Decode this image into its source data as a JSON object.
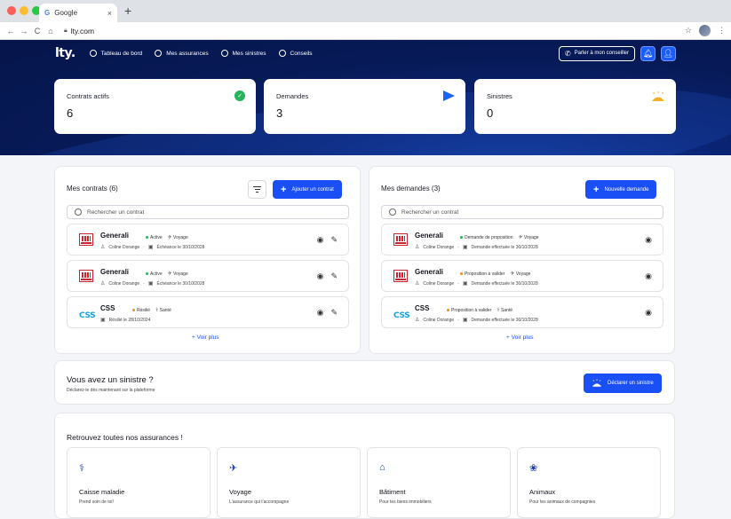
{
  "browser": {
    "tab_title": "Google",
    "tab_favicon": "G",
    "url": "lty.com",
    "new_tab": "+",
    "close": "×"
  },
  "topnav": {
    "logo": "lty.",
    "items": [
      "Tableau de bord",
      "Mes assurances",
      "Mes sinistres",
      "Conseils"
    ],
    "advisor_button": "Parler à mon conseiller"
  },
  "stats": [
    {
      "label": "Contrats actifs",
      "value": "6",
      "icon": "check-circle-icon",
      "color": "#25b35d"
    },
    {
      "label": "Demandes",
      "value": "3",
      "icon": "send-icon",
      "color": "#1a63f7"
    },
    {
      "label": "Sinistres",
      "value": "0",
      "icon": "umbrella-rain-icon",
      "color": "#f0b020"
    }
  ],
  "contracts": {
    "title": "Mes contrats (6)",
    "add_button": "Ajouter un contrat",
    "search_placeholder": "Rechercher un contrat",
    "see_more": "+ Voir plus",
    "items": [
      {
        "insurer": "Generali",
        "status": "Active",
        "status_color": "#25b35d",
        "category": "Voyage",
        "holder": "Coline Dorange",
        "date": "Échéance le 30/10/2028"
      },
      {
        "insurer": "Generali",
        "status": "Active",
        "status_color": "#25b35d",
        "category": "Voyage",
        "holder": "Coline Dorange",
        "date": "Échéance le 30/10/2028"
      },
      {
        "insurer": "CSS",
        "status": "Résilié",
        "status_color": "#f08a1c",
        "category": "Santé",
        "holder": "",
        "date": "Résilié le 28/10/2024"
      }
    ]
  },
  "requests": {
    "title": "Mes demandes (3)",
    "new_button": "Nouvelle demande",
    "search_placeholder": "Rechercher un contrat",
    "see_more": "+ Voir plus",
    "items": [
      {
        "insurer": "Generali",
        "status": "Demande de proposition",
        "status_color": "#25b35d",
        "category": "Voyage",
        "holder": "Coline Dorange",
        "date": "Demande effectuée le 30/10/2028"
      },
      {
        "insurer": "Generali",
        "status": "Proposition à valider",
        "status_color": "#f08a1c",
        "category": "Voyage",
        "holder": "Coline Dorange",
        "date": "Demande effectuée le 30/10/2028"
      },
      {
        "insurer": "CSS",
        "status": "Proposition à valider",
        "status_color": "#f08a1c",
        "category": "Santé",
        "holder": "Coline Dorange",
        "date": "Demande effectuée le 30/10/2028"
      }
    ]
  },
  "claim": {
    "title": "Vous avez un sinistre ?",
    "subtitle": "Déclarez-le dès maintenant sur la plateforme",
    "button": "Déclarer un sinistre"
  },
  "assurances": {
    "title": "Retrouvez toutes nos assurances !",
    "items": [
      {
        "title": "Caisse maladie",
        "subtitle": "Prend soin de toi!",
        "icon": "health-icon"
      },
      {
        "title": "Voyage",
        "subtitle": "L'assurance qui t'accompagne",
        "icon": "plane-icon"
      },
      {
        "title": "Bâtiment",
        "subtitle": "Pour tes biens immobiliers",
        "icon": "house-icon"
      },
      {
        "title": "Animaux",
        "subtitle": "Pour tes animaux de compagnies",
        "icon": "paw-icon"
      }
    ]
  }
}
